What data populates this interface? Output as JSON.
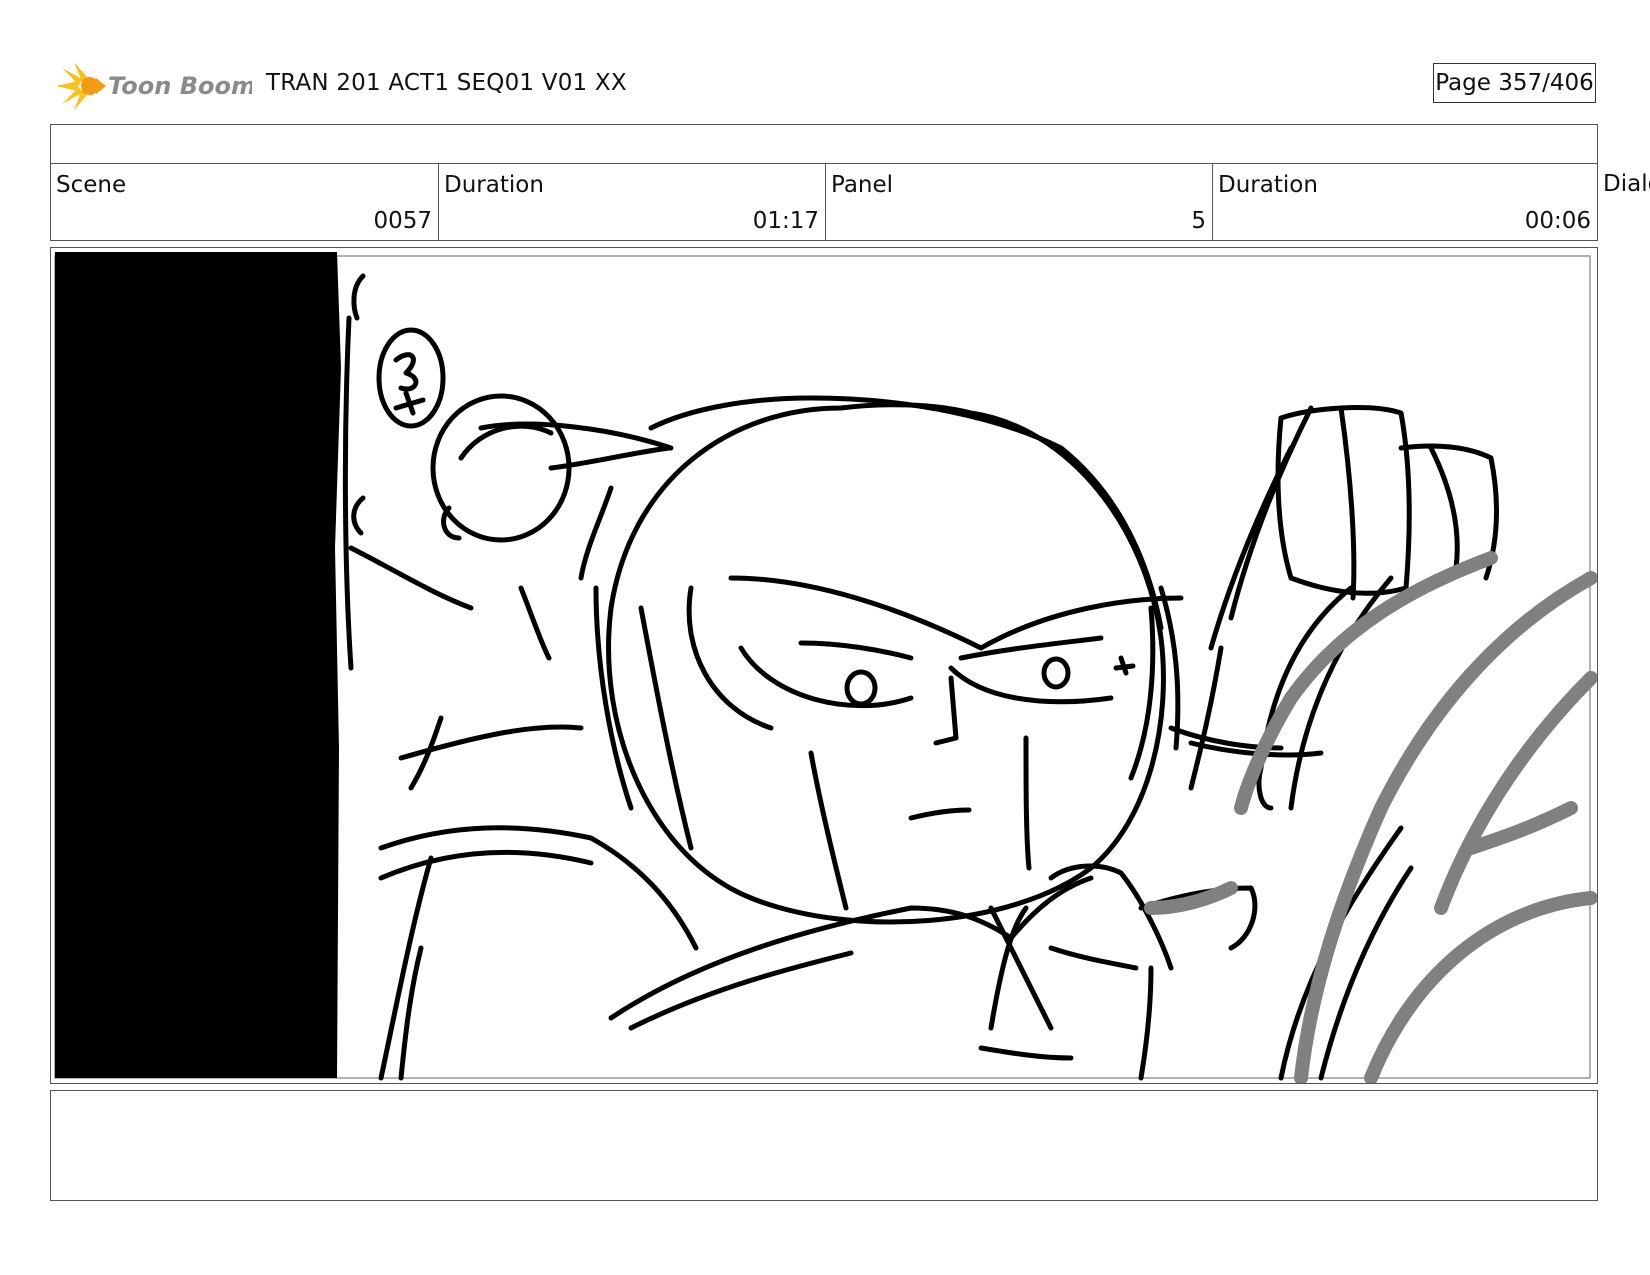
{
  "header": {
    "logo_text": "Toon Boom",
    "logo_icon": "starburst-icon",
    "title": "TRAN 201 ACT1 SEQ01 V01 XX",
    "page": "Page 357/406"
  },
  "info": {
    "scene_label": "Scene",
    "scene_value": "0057",
    "scene_duration_label": "Duration",
    "scene_duration_value": "01:17",
    "panel_label": "Panel",
    "panel_value": "5",
    "panel_duration_label": "Duration",
    "panel_duration_value": "00:06",
    "dialogue_label": "Dialo"
  },
  "panel": {
    "sketch_subject": "rough storyboard sketch: close-up of a character with a large round head and helmet, a smaller character in the upper left, black bar on the left edge",
    "colors": {
      "ink": "#000000",
      "gray_stroke": "#808080"
    }
  },
  "notes": {
    "text": ""
  }
}
